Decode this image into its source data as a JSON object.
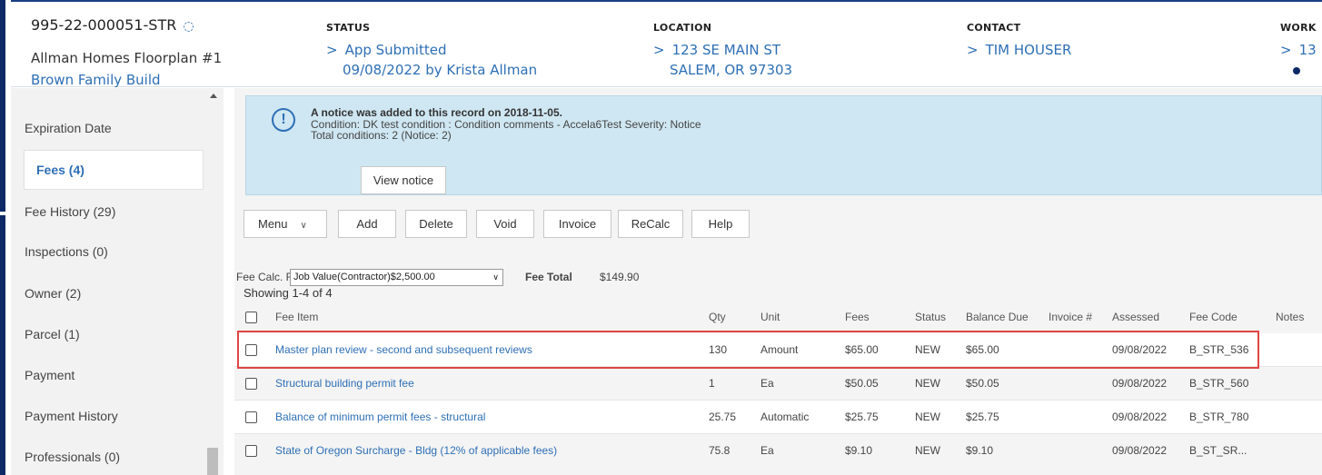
{
  "header": {
    "record_id": "995-22-000051-STR",
    "refresh_icon": "refresh-icon",
    "record_name": "Allman Homes Floorplan #1",
    "record_sub": "Brown Family Build",
    "status": {
      "label": "STATUS",
      "line1": "App Submitted",
      "line2": "09/08/2022 by Krista Allman"
    },
    "location": {
      "label": "LOCATION",
      "line1": "123 SE MAIN ST",
      "line2": "SALEM, OR 97303"
    },
    "contact": {
      "label": "CONTACT",
      "line1": "TIM HOUSER"
    },
    "work": {
      "label": "WORK",
      "line1": "13"
    }
  },
  "sidebar": {
    "items": [
      {
        "label": "Expiration Date"
      },
      {
        "label": "Fees (4)",
        "active": true
      },
      {
        "label": "Fee History (29)"
      },
      {
        "label": "Inspections (0)"
      },
      {
        "label": "Owner (2)"
      },
      {
        "label": "Parcel (1)"
      },
      {
        "label": "Payment"
      },
      {
        "label": "Payment History"
      },
      {
        "label": "Professionals (0)"
      }
    ]
  },
  "notice": {
    "icon": "info-icon",
    "title": "A notice was added to this record on 2018-11-05.",
    "line1": "Condition: DK test condition : Condition comments - Accela6Test Severity: Notice",
    "line2": "Total conditions: 2  (Notice: 2)",
    "button": "View notice"
  },
  "toolbar": {
    "menu": "Menu",
    "add": "Add",
    "delete": "Delete",
    "void": "Void",
    "invoice": "Invoice",
    "recalc": "ReCalc",
    "help": "Help"
  },
  "fee_calc": {
    "label": "Fee Calc. Factor:",
    "selected": "Job Value(Contractor)$2,500.00",
    "total_label": "Fee Total",
    "total_value": "$149.90",
    "showing": "Showing 1-4 of 4"
  },
  "table": {
    "columns": [
      "Fee Item",
      "Qty",
      "Unit",
      "Fees",
      "Status",
      "Balance Due",
      "Invoice #",
      "Assessed",
      "Fee Code",
      "Notes"
    ],
    "rows": [
      {
        "item": "Master plan review - second and subsequent reviews",
        "qty": "130",
        "unit": "Amount",
        "fees": "$65.00",
        "status": "NEW",
        "balance": "$65.00",
        "invoice": "",
        "assessed": "09/08/2022",
        "code": "B_STR_536",
        "notes": ""
      },
      {
        "item": "Structural building permit fee",
        "qty": "1",
        "unit": "Ea",
        "fees": "$50.05",
        "status": "NEW",
        "balance": "$50.05",
        "invoice": "",
        "assessed": "09/08/2022",
        "code": "B_STR_560",
        "notes": ""
      },
      {
        "item": "Balance of minimum permit fees - structural",
        "qty": "25.75",
        "unit": "Automatic",
        "fees": "$25.75",
        "status": "NEW",
        "balance": "$25.75",
        "invoice": "",
        "assessed": "09/08/2022",
        "code": "B_STR_780",
        "notes": ""
      },
      {
        "item": "State of Oregon Surcharge - Bldg (12% of applicable fees)",
        "qty": "75.8",
        "unit": "Ea",
        "fees": "$9.10",
        "status": "NEW",
        "balance": "$9.10",
        "invoice": "",
        "assessed": "09/08/2022",
        "code": "B_ST_SR...",
        "notes": ""
      }
    ]
  },
  "colors": {
    "accent": "#2e6fb5",
    "rail": "#0e2a66",
    "notice_bg": "#cfe7f2",
    "highlight": "#e04545"
  }
}
